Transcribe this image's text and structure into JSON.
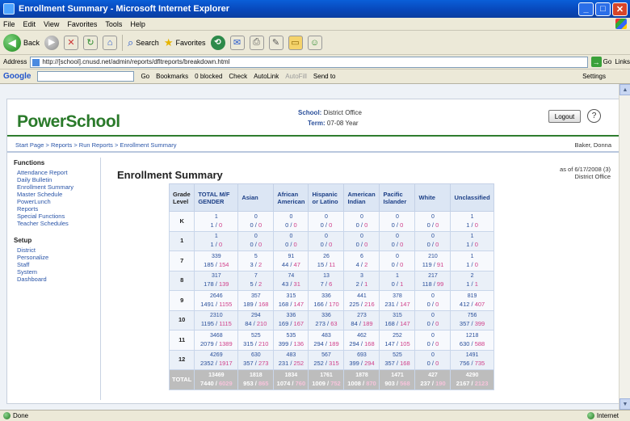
{
  "window": {
    "title": "Enrollment Summary - Microsoft Internet Explorer",
    "buttons": [
      "_",
      "□",
      "✕"
    ]
  },
  "menu": [
    "File",
    "Edit",
    "View",
    "Favorites",
    "Tools",
    "Help"
  ],
  "toolbar": {
    "back_label": "Back",
    "search_label": "Search",
    "favorites_label": "Favorites"
  },
  "address": {
    "label": "Address",
    "url": "http://[school].cnusd.net/admin/reports/dfltreports/breakdown.html",
    "go_label": "Go",
    "links_label": "Links"
  },
  "googlebar": {
    "logo": "Google",
    "items": [
      "Go",
      "Bookmarks",
      "0 blocked",
      "Check",
      "AutoLink",
      "AutoFill",
      "Send to"
    ],
    "settings_label": "Settings"
  },
  "powerschool": {
    "logo": "PowerSchool",
    "school_label": "School:",
    "school_value": "District Office",
    "term_label": "Term:",
    "term_value": "07-08 Year",
    "logout_label": "Logout",
    "breadcrumb": "Start Page > Reports > Run Reports > Enrollment Summary",
    "user": "Baker, Donna"
  },
  "sidebar": {
    "functions_heading": "Functions",
    "functions": [
      "Attendance Report",
      "Daily Bulletin",
      "Enrollment Summary",
      "Master Schedule",
      "PowerLunch",
      "Reports",
      "Special Functions",
      "Teacher Schedules"
    ],
    "setup_heading": "Setup",
    "setup": [
      "District",
      "Personalize",
      "Staff",
      "System",
      "Dashboard"
    ]
  },
  "main": {
    "title": "Enrollment Summary",
    "asof_line1": "as of 6/17/2008 (3)",
    "asof_line2": "District Office"
  },
  "table": {
    "headers": [
      "Grade Level",
      "TOTAL M/F GENDER",
      "Asian",
      "African American",
      "Hispanic or Latino",
      "American Indian",
      "Pacific Islander",
      "White",
      "Unclassified"
    ],
    "rows": [
      {
        "grade": "K",
        "cells": [
          [
            "1",
            "1",
            "0"
          ],
          [
            "0",
            "0",
            "0"
          ],
          [
            "0",
            "0",
            "0"
          ],
          [
            "0",
            "0",
            "0"
          ],
          [
            "0",
            "0",
            "0"
          ],
          [
            "0",
            "0",
            "0"
          ],
          [
            "0",
            "0",
            "0"
          ],
          [
            "1",
            "1",
            "0"
          ]
        ]
      },
      {
        "grade": "1",
        "cells": [
          [
            "1",
            "1",
            "0"
          ],
          [
            "0",
            "0",
            "0"
          ],
          [
            "0",
            "0",
            "0"
          ],
          [
            "0",
            "0",
            "0"
          ],
          [
            "0",
            "0",
            "0"
          ],
          [
            "0",
            "0",
            "0"
          ],
          [
            "0",
            "0",
            "0"
          ],
          [
            "1",
            "1",
            "0"
          ]
        ]
      },
      {
        "grade": "7",
        "cells": [
          [
            "339",
            "185",
            "154"
          ],
          [
            "5",
            "3",
            "2"
          ],
          [
            "91",
            "44",
            "47"
          ],
          [
            "26",
            "15",
            "11"
          ],
          [
            "6",
            "4",
            "2"
          ],
          [
            "0",
            "0",
            "0"
          ],
          [
            "210",
            "119",
            "91"
          ],
          [
            "1",
            "1",
            "0"
          ]
        ]
      },
      {
        "grade": "8",
        "cells": [
          [
            "317",
            "178",
            "139"
          ],
          [
            "7",
            "5",
            "2"
          ],
          [
            "74",
            "43",
            "31"
          ],
          [
            "13",
            "7",
            "6"
          ],
          [
            "3",
            "2",
            "1"
          ],
          [
            "1",
            "0",
            "1"
          ],
          [
            "217",
            "118",
            "99"
          ],
          [
            "2",
            "1",
            "1"
          ]
        ]
      },
      {
        "grade": "9",
        "cells": [
          [
            "2646",
            "1491",
            "1155"
          ],
          [
            "357",
            "189",
            "168"
          ],
          [
            "315",
            "168",
            "147"
          ],
          [
            "336",
            "166",
            "170"
          ],
          [
            "441",
            "225",
            "216"
          ],
          [
            "378",
            "231",
            "147"
          ],
          [
            "0",
            "0",
            "0"
          ],
          [
            "819",
            "412",
            "407"
          ]
        ]
      },
      {
        "grade": "10",
        "cells": [
          [
            "2310",
            "1195",
            "1115"
          ],
          [
            "294",
            "84",
            "210"
          ],
          [
            "336",
            "169",
            "167"
          ],
          [
            "336",
            "273",
            "63"
          ],
          [
            "273",
            "84",
            "189"
          ],
          [
            "315",
            "168",
            "147"
          ],
          [
            "0",
            "0",
            "0"
          ],
          [
            "756",
            "357",
            "399"
          ]
        ]
      },
      {
        "grade": "11",
        "cells": [
          [
            "3468",
            "2079",
            "1389"
          ],
          [
            "525",
            "315",
            "210"
          ],
          [
            "535",
            "399",
            "136"
          ],
          [
            "483",
            "294",
            "189"
          ],
          [
            "462",
            "294",
            "168"
          ],
          [
            "252",
            "147",
            "105"
          ],
          [
            "0",
            "0",
            "0"
          ],
          [
            "1218",
            "630",
            "588"
          ]
        ]
      },
      {
        "grade": "12",
        "cells": [
          [
            "4269",
            "2352",
            "1917"
          ],
          [
            "630",
            "357",
            "273"
          ],
          [
            "483",
            "231",
            "252"
          ],
          [
            "567",
            "252",
            "315"
          ],
          [
            "693",
            "399",
            "294"
          ],
          [
            "525",
            "357",
            "168"
          ],
          [
            "0",
            "0",
            "0"
          ],
          [
            "1491",
            "756",
            "735"
          ]
        ]
      }
    ],
    "total": {
      "grade": "TOTAL",
      "cells": [
        [
          "13469",
          "7440",
          "6029"
        ],
        [
          "1818",
          "953",
          "865"
        ],
        [
          "1834",
          "1074",
          "760"
        ],
        [
          "1761",
          "1009",
          "752"
        ],
        [
          "1878",
          "1008",
          "870"
        ],
        [
          "1471",
          "903",
          "568"
        ],
        [
          "427",
          "237",
          "190"
        ],
        [
          "4290",
          "2167",
          "2123"
        ]
      ]
    }
  },
  "status": {
    "left": "Done",
    "zone": "Internet"
  }
}
